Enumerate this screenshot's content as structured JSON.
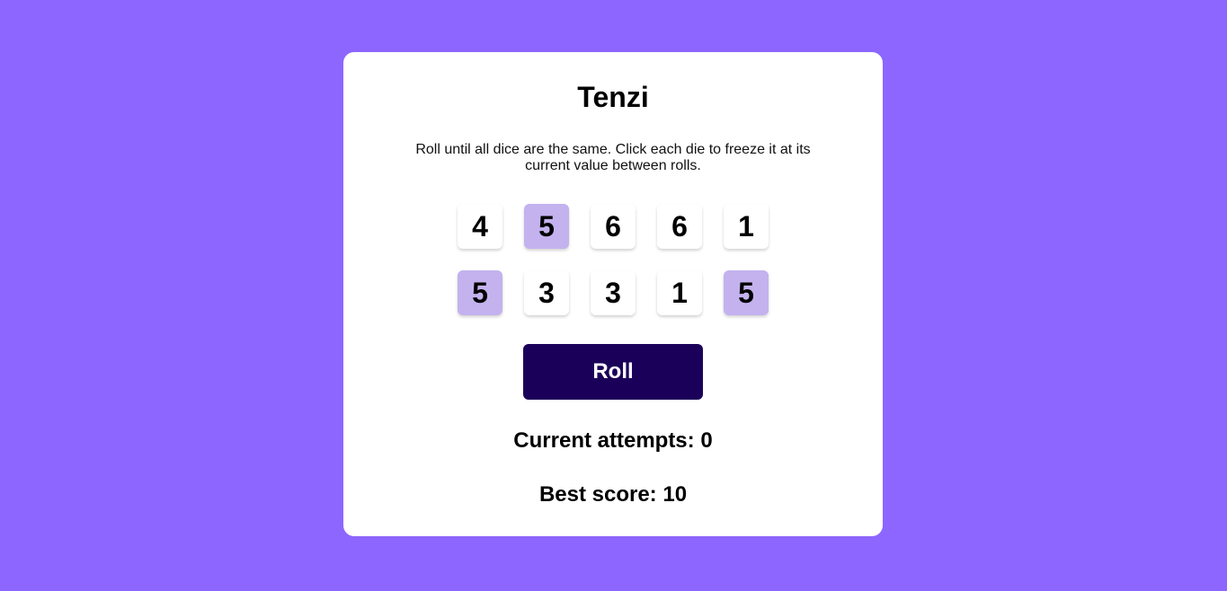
{
  "game": {
    "title": "Tenzi",
    "instructions": "Roll until all dice are the same. Click each die to freeze it at its current value between rolls.",
    "roll_label": "Roll",
    "current_attempts_label": "Current attempts:",
    "current_attempts": "0",
    "best_score_label": "Best score:",
    "best_score": "10"
  },
  "dice": [
    {
      "value": "4",
      "held": false
    },
    {
      "value": "5",
      "held": true
    },
    {
      "value": "6",
      "held": false
    },
    {
      "value": "6",
      "held": false
    },
    {
      "value": "1",
      "held": false
    },
    {
      "value": "5",
      "held": true
    },
    {
      "value": "3",
      "held": false
    },
    {
      "value": "3",
      "held": false
    },
    {
      "value": "1",
      "held": false
    },
    {
      "value": "5",
      "held": true
    }
  ],
  "colors": {
    "background": "#8c66ff",
    "card": "#ffffff",
    "die": "#ffffff",
    "die_held": "#c3b2ee",
    "roll_button": "#1b0059"
  }
}
